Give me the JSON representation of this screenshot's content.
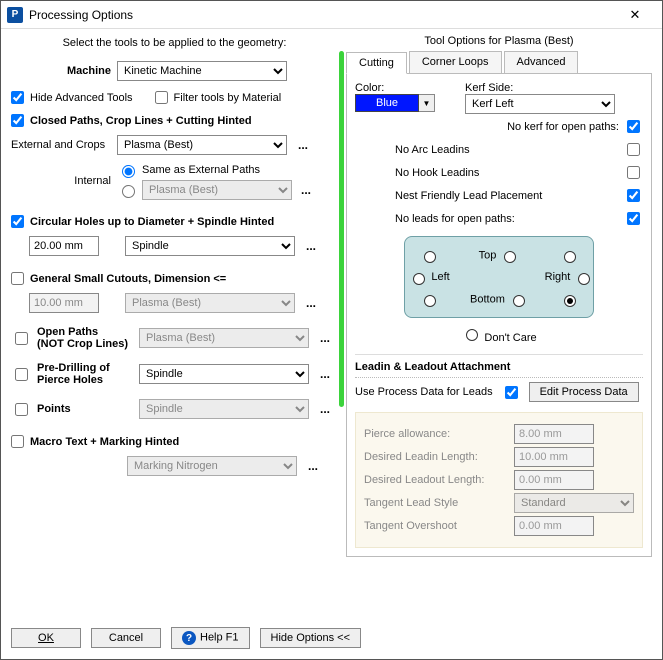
{
  "window": {
    "title": "Processing Options",
    "app_icon_letter": "P"
  },
  "left": {
    "intro": "Select the tools to be applied to the geometry:",
    "machine_label": "Machine",
    "machine_value": "Kinetic Machine",
    "hide_advanced": "Hide Advanced Tools",
    "filter_by_material": "Filter tools by Material",
    "closed_paths": "Closed Paths,  Crop Lines  +   Cutting Hinted",
    "external_label": "External and Crops",
    "external_value": "Plasma (Best)",
    "internal_label": "Internal",
    "same_as_external": "Same as External Paths",
    "internal_value": "Plasma (Best)",
    "circ_holes": "Circular Holes up to Diameter   +  Spindle Hinted",
    "circ_value": "20.00 mm",
    "circ_tool": "Spindle",
    "gen_small": "General Small Cutouts, Dimension <=",
    "gen_small_value": "10.00 mm",
    "gen_small_tool": "Plasma (Best)",
    "open_paths_l1": "Open Paths",
    "open_paths_l2": "(NOT Crop Lines)",
    "open_paths_tool": "Plasma (Best)",
    "predrill_l1": "Pre-Drilling of",
    "predrill_l2": "Pierce Holes",
    "predrill_tool": "Spindle",
    "points": "Points",
    "points_tool": "Spindle",
    "macro_text": "Macro Text   +  Marking Hinted",
    "macro_tool": "Marking Nitrogen",
    "ellipsis": "..."
  },
  "right": {
    "title": "Tool Options for Plasma (Best)",
    "tabs": [
      "Cutting",
      "Corner Loops",
      "Advanced"
    ],
    "color_label": "Color:",
    "color_value": "Blue",
    "kerf_label": "Kerf Side:",
    "kerf_value": "Kerf Left",
    "no_kerf_open": "No kerf for open paths:",
    "opts": {
      "no_arc": "No Arc Leadins",
      "no_hook": "No Hook Leadins",
      "nest_friendly": "Nest Friendly Lead Placement",
      "no_leads_open": "No leads for open paths:"
    },
    "leadbox": {
      "top": "Top",
      "bottom": "Bottom",
      "left": "Left",
      "right": "Right"
    },
    "dont_care": "Don't Care",
    "leadin_header": "Leadin & Leadout Attachment",
    "use_process_leads": "Use Process Data for Leads",
    "edit_process": "Edit Process Data",
    "fields": {
      "pierce_allow_label": "Pierce allowance:",
      "pierce_allow_value": "8.00 mm",
      "leadin_label": "Desired Leadin Length:",
      "leadin_value": "10.00 mm",
      "leadout_label": "Desired Leadout Length:",
      "leadout_value": "0.00 mm",
      "tangent_style_label": "Tangent Lead Style",
      "tangent_style_value": "Standard",
      "tangent_over_label": "Tangent Overshoot",
      "tangent_over_value": "0.00 mm"
    }
  },
  "footer": {
    "ok": "OK",
    "cancel": "Cancel",
    "help": "Help F1",
    "hide_options": "Hide Options <<"
  }
}
